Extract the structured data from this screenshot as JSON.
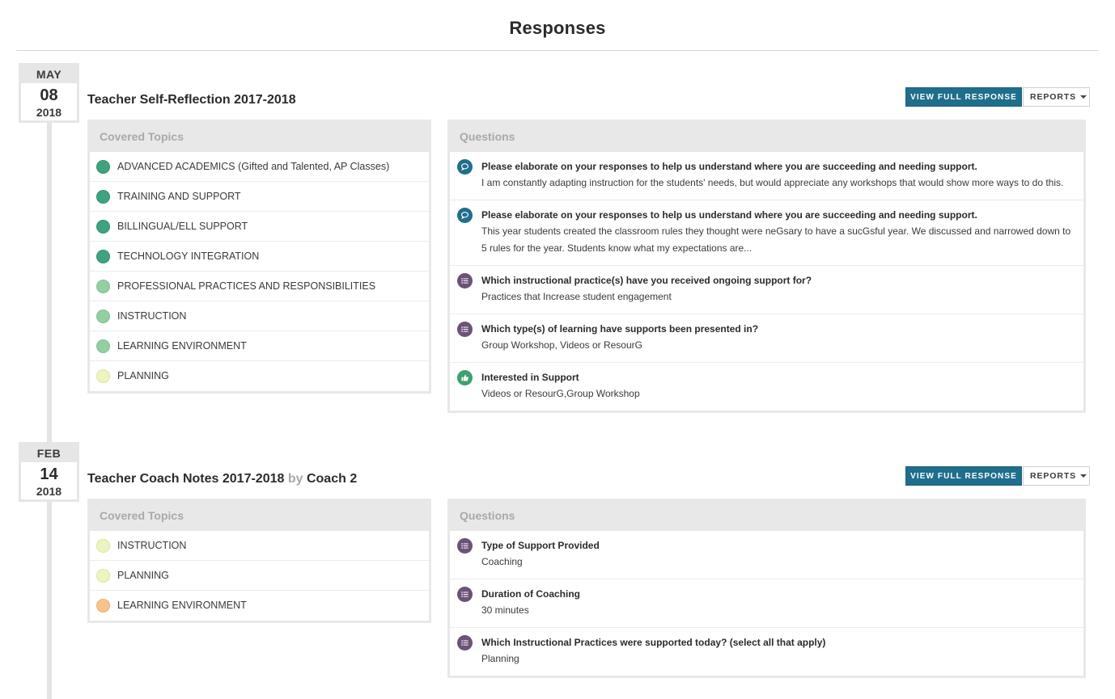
{
  "page": {
    "title": "Responses"
  },
  "responses": [
    {
      "date": {
        "month": "MAY",
        "day": "08",
        "year": "2018"
      },
      "title": "Teacher Self-Reflection 2017-2018",
      "by_label": "",
      "author": "",
      "buttons": {
        "view": "VIEW FULL RESPONSE",
        "reports": "REPORTS"
      },
      "topics_header": "Covered Topics",
      "topics": [
        {
          "label": "ADVANCED ACADEMICS (Gifted and Talented, AP Classes)",
          "color": "#3fa37f"
        },
        {
          "label": "TRAINING AND SUPPORT",
          "color": "#3fa37f"
        },
        {
          "label": "BILLINGUAL/ELL SUPPORT",
          "color": "#3fa37f"
        },
        {
          "label": "TECHNOLOGY INTEGRATION",
          "color": "#3fa37f"
        },
        {
          "label": "PROFESSIONAL PRACTICES AND RESPONSIBILITIES",
          "color": "#93cfa1"
        },
        {
          "label": "INSTRUCTION",
          "color": "#93cfa1"
        },
        {
          "label": "LEARNING ENVIRONMENT",
          "color": "#93cfa1"
        },
        {
          "label": "PLANNING",
          "color": "#eef4bf"
        }
      ],
      "questions_header": "Questions",
      "questions": [
        {
          "icon": "comment-icon",
          "title": "Please elaborate on your responses to help us understand where you are succeeding and needing support.",
          "answer": "I am constantly adapting instruction for the students' needs, but would appreciate any workshops that would show more ways to do this."
        },
        {
          "icon": "comment-icon",
          "title": "Please elaborate on your responses to help us understand where you are succeeding and needing support.",
          "answer": "This year students created the classroom rules they thought were neGsary to have a sucGsful year. We discussed and narrowed down to 5 rules for the year. Students know what my expectations are..."
        },
        {
          "icon": "list-icon",
          "title": "Which instructional practice(s) have you received ongoing support for?",
          "answer": "Practices that Increase student engagement"
        },
        {
          "icon": "list-icon",
          "title": "Which type(s) of learning have supports been presented in?",
          "answer": "Group Workshop, Videos or ResourG"
        },
        {
          "icon": "thumbs-up-icon",
          "title": "Interested in Support",
          "answer": "Videos or ResourG,Group Workshop"
        }
      ]
    },
    {
      "date": {
        "month": "FEB",
        "day": "14",
        "year": "2018"
      },
      "title": "Teacher Coach Notes 2017-2018",
      "by_label": "by",
      "author": "Coach 2",
      "buttons": {
        "view": "VIEW FULL RESPONSE",
        "reports": "REPORTS"
      },
      "topics_header": "Covered Topics",
      "topics": [
        {
          "label": "INSTRUCTION",
          "color": "#eef4bf"
        },
        {
          "label": "PLANNING",
          "color": "#eef4bf"
        },
        {
          "label": "LEARNING ENVIRONMENT",
          "color": "#f6c489"
        }
      ],
      "questions_header": "Questions",
      "questions": [
        {
          "icon": "list-icon",
          "title": "Type of Support Provided",
          "answer": "Coaching"
        },
        {
          "icon": "list-icon",
          "title": "Duration of Coaching",
          "answer": "30 minutes"
        },
        {
          "icon": "list-icon",
          "title": "Which Instructional Practices were supported today? (select all that apply)",
          "answer": "Planning"
        }
      ]
    }
  ]
}
